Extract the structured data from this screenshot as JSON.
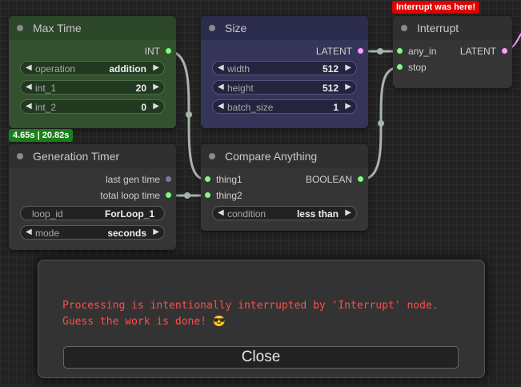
{
  "colors": {
    "accent_green": "#7bff7b",
    "accent_pink": "#ff9cff",
    "error_red": "#ff4d4d",
    "badge_green": "#1a7f1a",
    "badge_red": "#e00000"
  },
  "nodes": {
    "max_time": {
      "title": "Max Time",
      "output": "INT",
      "widgets": [
        {
          "label": "operation",
          "value": "addition"
        },
        {
          "label": "int_1",
          "value": "20"
        },
        {
          "label": "int_2",
          "value": "0"
        }
      ]
    },
    "size": {
      "title": "Size",
      "output": "LATENT",
      "widgets": [
        {
          "label": "width",
          "value": "512"
        },
        {
          "label": "height",
          "value": "512"
        },
        {
          "label": "batch_size",
          "value": "1"
        }
      ]
    },
    "interrupt": {
      "title": "Interrupt",
      "badge": "Interrupt was here!",
      "inputs": [
        "any_in",
        "stop"
      ],
      "output": "LATENT"
    },
    "generation_timer": {
      "title": "Generation Timer",
      "badge": "4.65s | 20.82s",
      "outputs": [
        "last gen time",
        "total loop time"
      ],
      "widgets": [
        {
          "label": "loop_id",
          "value": "ForLoop_1"
        },
        {
          "label": "mode",
          "value": "seconds"
        }
      ]
    },
    "compare_anything": {
      "title": "Compare Anything",
      "inputs": [
        "thing1",
        "thing2"
      ],
      "output": "BOOLEAN",
      "widgets": [
        {
          "label": "condition",
          "value": "less than"
        }
      ]
    }
  },
  "modal": {
    "message": "Processing is intentionally interrupted by 'Interrupt' node.\nGuess the work is done! 😎",
    "close_label": "Close"
  }
}
